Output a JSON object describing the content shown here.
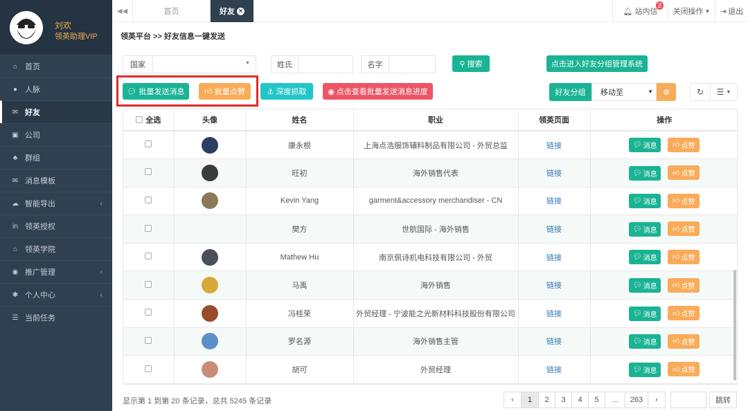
{
  "profile": {
    "name": "刘欢",
    "role": "领英助理VIP"
  },
  "sidebar": {
    "items": [
      {
        "label": "首页",
        "icon": "home-icon",
        "glyph": "⌂"
      },
      {
        "label": "人脉",
        "icon": "user-icon",
        "glyph": "●"
      },
      {
        "label": "好友",
        "icon": "chat-icon",
        "glyph": "✉",
        "active": true
      },
      {
        "label": "公司",
        "icon": "briefcase-icon",
        "glyph": "▣"
      },
      {
        "label": "群组",
        "icon": "users-icon",
        "glyph": "♣"
      },
      {
        "label": "消息模板",
        "icon": "envelope-icon",
        "glyph": "✉"
      },
      {
        "label": "智能导出",
        "icon": "cloud-download-icon",
        "glyph": "☁",
        "arrow": "‹"
      },
      {
        "label": "领英授权",
        "icon": "linkedin-icon",
        "glyph": "in"
      },
      {
        "label": "领英学院",
        "icon": "institution-icon",
        "glyph": "⌂"
      },
      {
        "label": "推广管理",
        "icon": "soccer-icon",
        "glyph": "◉",
        "arrow": "‹"
      },
      {
        "label": "个人中心",
        "icon": "gear-icon",
        "glyph": "✱",
        "arrow": "‹"
      },
      {
        "label": "当前任务",
        "icon": "tasks-icon",
        "glyph": "☰"
      }
    ]
  },
  "tabs": {
    "back": "◀◀",
    "home": "首页",
    "friends": "好友",
    "close": "×"
  },
  "topbar": {
    "notifications": "站内信",
    "notification_count": "2",
    "close_ops": "关闭操作",
    "logout": "退出"
  },
  "breadcrumb": "领英平台 >> 好友信息一键发送",
  "filters": {
    "country_label": "国家",
    "surname_label": "姓氏",
    "name_label": "名字",
    "search_button": "搜索",
    "group_mgmt_button": "点击进入好友分组管理系统"
  },
  "actions": {
    "batch_message": "批量发送消息",
    "batch_like": "批量点赞",
    "deep_fetch": "深度抓取",
    "view_progress": "点击查看批量发送消息进度",
    "group_label": "好友分组",
    "move_to": "移动至"
  },
  "table": {
    "headers": [
      "全选",
      "头像",
      "姓名",
      "职业",
      "领英页面",
      "操作"
    ],
    "link_text": "链接",
    "msg_btn": "消息",
    "like_btn": "点赞",
    "rows": [
      {
        "name": "康永根",
        "job": "上海点浩服饰辅料制品有限公司 - 外贸总监",
        "face": "#2c3e64"
      },
      {
        "name": "旺初",
        "job": "海外销售代表",
        "face": "#3b3b3b"
      },
      {
        "name": "Kevin Yang",
        "job": "garment&accessory merchandiser - CN",
        "face": "#8a7a5a"
      },
      {
        "name": "樊方",
        "job": "世航国际 - 海外销售",
        "face": ""
      },
      {
        "name": "Mathew Hu",
        "job": "南京佩诗机电科技有限公司 - 外贸",
        "face": "#4a4f5a"
      },
      {
        "name": "马禹",
        "job": "海外销售",
        "face": "#d9a83a"
      },
      {
        "name": "冯桂荣",
        "job": "外贸经理 - 宁波能之光新材料科技股份有限公司",
        "face": "#9a4a2a"
      },
      {
        "name": "罗名源",
        "job": "海外销售主管",
        "face": "#5b8fc8"
      },
      {
        "name": "胡可",
        "job": "外贸经理",
        "face": "#c98b7a"
      }
    ]
  },
  "footer": {
    "info": "显示第 1 到第 20 条记录，总共 5245 条记录",
    "pages": [
      "‹",
      "1",
      "2",
      "3",
      "4",
      "5",
      "...",
      "263",
      "›"
    ],
    "jump": "跳转"
  },
  "colors": {
    "sidebar": "#2f4050",
    "teal": "#1ab394",
    "orange": "#f8ac59",
    "cyan": "#23c6c8",
    "red": "#ed5565",
    "profile_text": "#f0ad4e"
  }
}
